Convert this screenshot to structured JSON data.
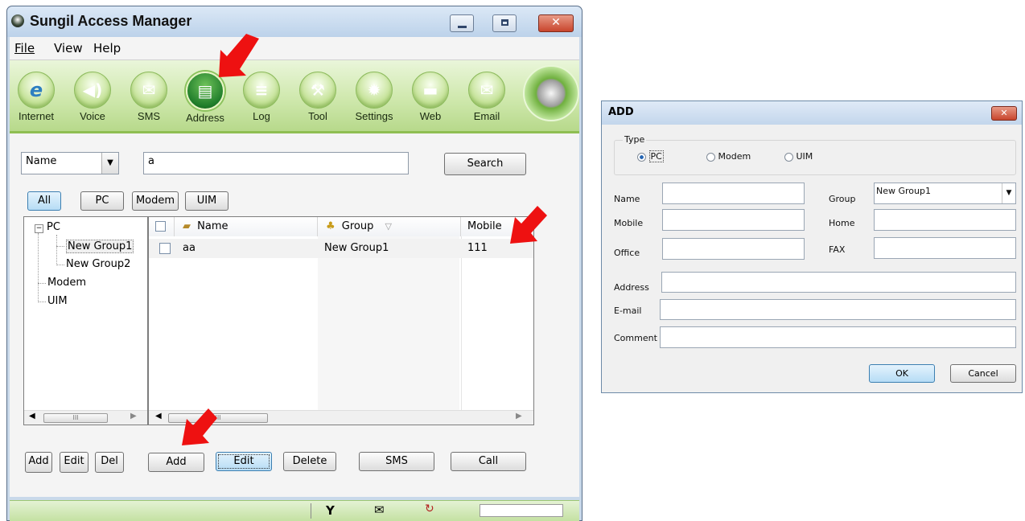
{
  "main_window": {
    "title": "Sungil Access Manager",
    "menu": [
      "File",
      "View",
      "Help"
    ],
    "toolbar": [
      "Internet",
      "Voice",
      "SMS",
      "Address",
      "Log",
      "Tool",
      "Settings",
      "Web",
      "Email"
    ],
    "active_tool": "Address",
    "search": {
      "field_select": "Name",
      "query": "a",
      "button": "Search"
    },
    "filters": [
      "All",
      "PC",
      "Modem",
      "UIM"
    ],
    "selected_filter": "All",
    "tree": {
      "root": "PC",
      "children": [
        "New Group1",
        "New Group2"
      ],
      "others": [
        "Modem",
        "UIM"
      ]
    },
    "table": {
      "headers": {
        "name": "Name",
        "group": "Group",
        "mobile": "Mobile"
      },
      "rows": [
        {
          "name": "aa",
          "group": "New Group1",
          "mobile": "111"
        }
      ]
    },
    "tree_buttons": [
      "Add",
      "Edit",
      "Del"
    ],
    "actions": [
      "Add",
      "Edit",
      "Delete",
      "SMS",
      "Call"
    ],
    "status_icons": [
      "signal-icon",
      "envelope-icon",
      "sync-icon"
    ],
    "scroll_marker": "III"
  },
  "dialog": {
    "title": "ADD",
    "type_group_label": "Type",
    "type_options": [
      "PC",
      "Modem",
      "UIM"
    ],
    "selected_type": "PC",
    "labels": {
      "name": "Name",
      "group": "Group",
      "mobile": "Mobile",
      "home": "Home",
      "office": "Office",
      "fax": "FAX",
      "address": "Address",
      "email": "E-mail",
      "comment": "Comment"
    },
    "group_value": "New Group1",
    "ok": "OK",
    "cancel": "Cancel"
  },
  "colors": {
    "arrow": "#ee1111",
    "toolbar": "#cfe8ad",
    "selection": "#b6dcf5"
  }
}
